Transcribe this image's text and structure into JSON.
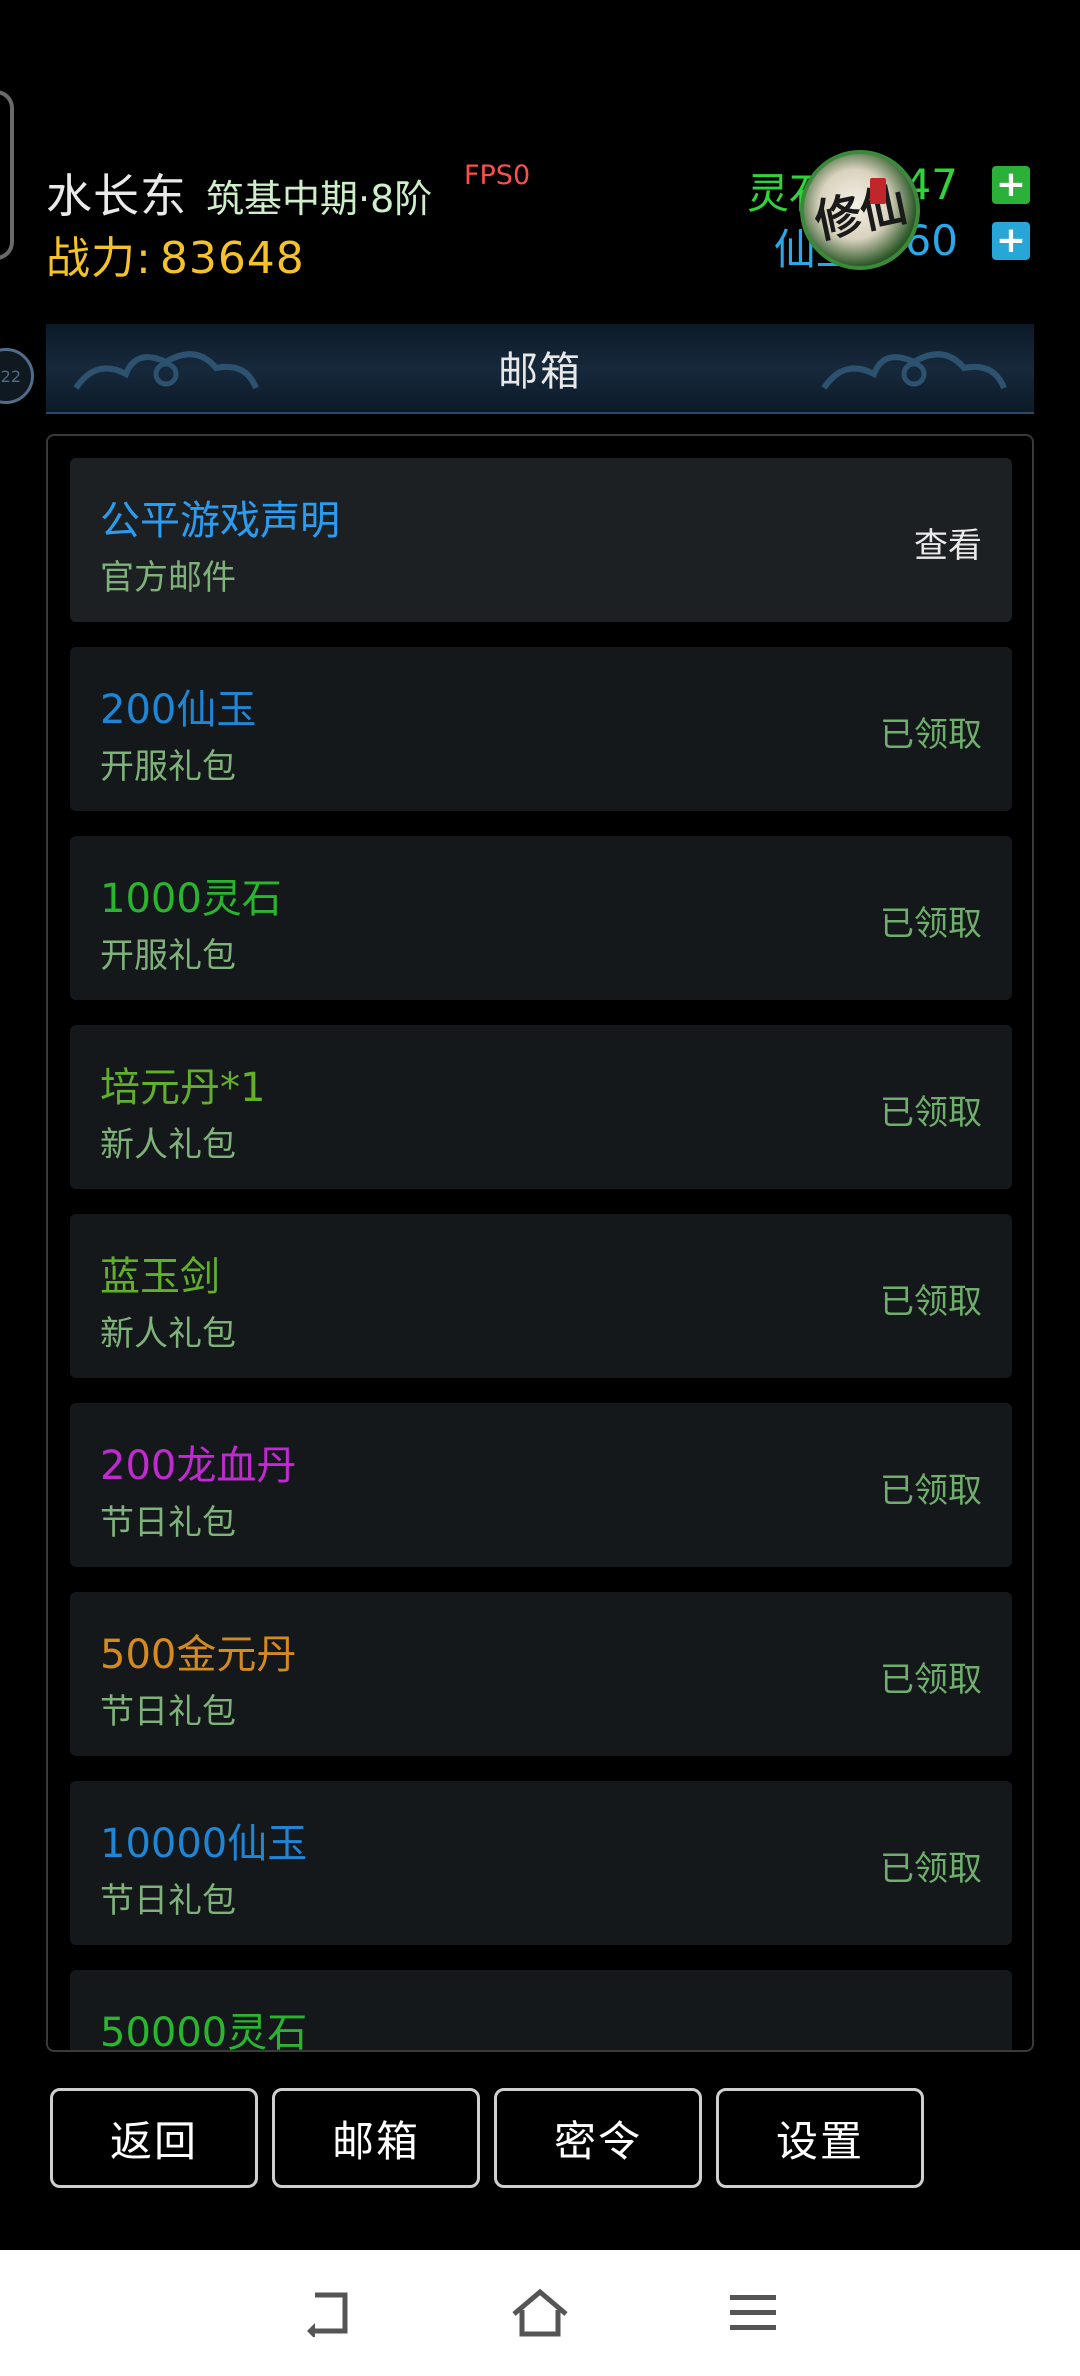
{
  "header": {
    "player_name": "水长东",
    "realm": "筑基中期·8阶",
    "fps": "FPS0",
    "power_label": "战力:",
    "power_value": "83648",
    "spirit_stone_label": "灵石:",
    "spirit_stone_value": "7··47",
    "jade_label": "仙玉:",
    "jade_value": "··60",
    "side_badge": "22",
    "logo_text": "修仙"
  },
  "panel": {
    "title": "邮箱"
  },
  "mails": [
    {
      "title": "公平游戏声明",
      "subtitle": "官方邮件",
      "status": "查看",
      "title_color": "#2b9cf0"
    },
    {
      "title": "200仙玉",
      "subtitle": "开服礼包",
      "status": "已领取",
      "title_color": "#1f86d6"
    },
    {
      "title": "1000灵石",
      "subtitle": "开服礼包",
      "status": "已领取",
      "title_color": "#2ab52f"
    },
    {
      "title": "培元丹*1",
      "subtitle": "新人礼包",
      "status": "已领取",
      "title_color": "#62b02a"
    },
    {
      "title": "蓝玉剑",
      "subtitle": "新人礼包",
      "status": "已领取",
      "title_color": "#62b02a"
    },
    {
      "title": "200龙血丹",
      "subtitle": "节日礼包",
      "status": "已领取",
      "title_color": "#c02ad0"
    },
    {
      "title": "500金元丹",
      "subtitle": "节日礼包",
      "status": "已领取",
      "title_color": "#d48a1e"
    },
    {
      "title": "10000仙玉",
      "subtitle": "节日礼包",
      "status": "已领取",
      "title_color": "#1f86d6"
    },
    {
      "title": "50000灵石",
      "subtitle": "",
      "status": "",
      "title_color": "#2ab52f"
    }
  ],
  "buttons": {
    "back": "返回",
    "mailbox": "邮箱",
    "code": "密令",
    "settings": "设置"
  }
}
